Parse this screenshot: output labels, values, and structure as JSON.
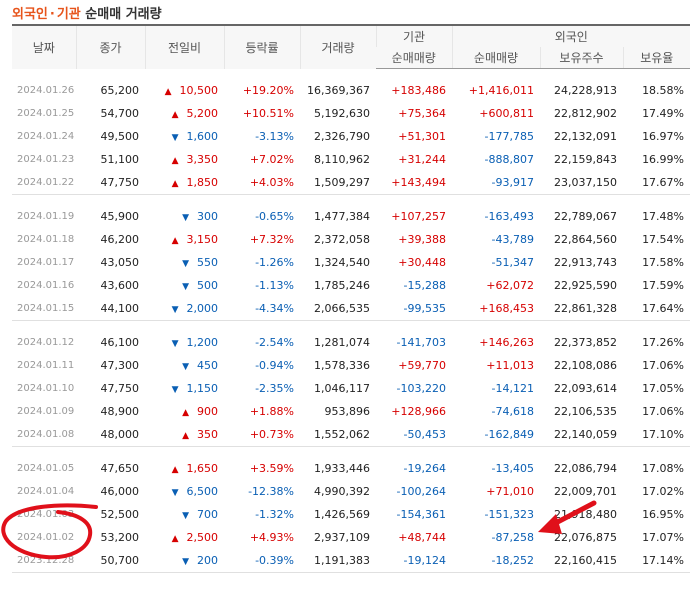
{
  "title": {
    "part1": "외국인",
    "sep": "·",
    "part2": "기관",
    "part3": "순매매 거래량"
  },
  "headers": {
    "date": "날짜",
    "close": "종가",
    "change": "전일비",
    "rate": "등락률",
    "volume": "거래량",
    "inst_group": "기관",
    "foreign_group": "외국인",
    "inst_net": "순매매량",
    "foreign_net": "순매매량",
    "holdings": "보유주수",
    "ratio": "보유율"
  },
  "groups": [
    [
      {
        "date": "2024.01.26",
        "close": "65,200",
        "dir": "up",
        "change": "10,500",
        "rate": "+19.20%",
        "volume": "16,369,367",
        "inst": "+183,486",
        "foreign": "+1,416,011",
        "holdings": "24,228,913",
        "ratio": "18.58%"
      },
      {
        "date": "2024.01.25",
        "close": "54,700",
        "dir": "up",
        "change": "5,200",
        "rate": "+10.51%",
        "volume": "5,192,630",
        "inst": "+75,364",
        "foreign": "+600,811",
        "holdings": "22,812,902",
        "ratio": "17.49%"
      },
      {
        "date": "2024.01.24",
        "close": "49,500",
        "dir": "dn",
        "change": "1,600",
        "rate": "-3.13%",
        "volume": "2,326,790",
        "inst": "+51,301",
        "foreign": "-177,785",
        "holdings": "22,132,091",
        "ratio": "16.97%"
      },
      {
        "date": "2024.01.23",
        "close": "51,100",
        "dir": "up",
        "change": "3,350",
        "rate": "+7.02%",
        "volume": "8,110,962",
        "inst": "+31,244",
        "foreign": "-888,807",
        "holdings": "22,159,843",
        "ratio": "16.99%"
      },
      {
        "date": "2024.01.22",
        "close": "47,750",
        "dir": "up",
        "change": "1,850",
        "rate": "+4.03%",
        "volume": "1,509,297",
        "inst": "+143,494",
        "foreign": "-93,917",
        "holdings": "23,037,150",
        "ratio": "17.67%"
      }
    ],
    [
      {
        "date": "2024.01.19",
        "close": "45,900",
        "dir": "dn",
        "change": "300",
        "rate": "-0.65%",
        "volume": "1,477,384",
        "inst": "+107,257",
        "foreign": "-163,493",
        "holdings": "22,789,067",
        "ratio": "17.48%"
      },
      {
        "date": "2024.01.18",
        "close": "46,200",
        "dir": "up",
        "change": "3,150",
        "rate": "+7.32%",
        "volume": "2,372,058",
        "inst": "+39,388",
        "foreign": "-43,789",
        "holdings": "22,864,560",
        "ratio": "17.54%"
      },
      {
        "date": "2024.01.17",
        "close": "43,050",
        "dir": "dn",
        "change": "550",
        "rate": "-1.26%",
        "volume": "1,324,540",
        "inst": "+30,448",
        "foreign": "-51,347",
        "holdings": "22,913,743",
        "ratio": "17.58%"
      },
      {
        "date": "2024.01.16",
        "close": "43,600",
        "dir": "dn",
        "change": "500",
        "rate": "-1.13%",
        "volume": "1,785,246",
        "inst": "-15,288",
        "foreign": "+62,072",
        "holdings": "22,925,590",
        "ratio": "17.59%"
      },
      {
        "date": "2024.01.15",
        "close": "44,100",
        "dir": "dn",
        "change": "2,000",
        "rate": "-4.34%",
        "volume": "2,066,535",
        "inst": "-99,535",
        "foreign": "+168,453",
        "holdings": "22,861,328",
        "ratio": "17.64%"
      }
    ],
    [
      {
        "date": "2024.01.12",
        "close": "46,100",
        "dir": "dn",
        "change": "1,200",
        "rate": "-2.54%",
        "volume": "1,281,074",
        "inst": "-141,703",
        "foreign": "+146,263",
        "holdings": "22,373,852",
        "ratio": "17.26%"
      },
      {
        "date": "2024.01.11",
        "close": "47,300",
        "dir": "dn",
        "change": "450",
        "rate": "-0.94%",
        "volume": "1,578,336",
        "inst": "+59,770",
        "foreign": "+11,013",
        "holdings": "22,108,086",
        "ratio": "17.06%"
      },
      {
        "date": "2024.01.10",
        "close": "47,750",
        "dir": "dn",
        "change": "1,150",
        "rate": "-2.35%",
        "volume": "1,046,117",
        "inst": "-103,220",
        "foreign": "-14,121",
        "holdings": "22,093,614",
        "ratio": "17.05%"
      },
      {
        "date": "2024.01.09",
        "close": "48,900",
        "dir": "up",
        "change": "900",
        "rate": "+1.88%",
        "volume": "953,896",
        "inst": "+128,966",
        "foreign": "-74,618",
        "holdings": "22,106,535",
        "ratio": "17.06%"
      },
      {
        "date": "2024.01.08",
        "close": "48,000",
        "dir": "up",
        "change": "350",
        "rate": "+0.73%",
        "volume": "1,552,062",
        "inst": "-50,453",
        "foreign": "-162,849",
        "holdings": "22,140,059",
        "ratio": "17.10%"
      }
    ],
    [
      {
        "date": "2024.01.05",
        "close": "47,650",
        "dir": "up",
        "change": "1,650",
        "rate": "+3.59%",
        "volume": "1,933,446",
        "inst": "-19,264",
        "foreign": "-13,405",
        "holdings": "22,086,794",
        "ratio": "17.08%"
      },
      {
        "date": "2024.01.04",
        "close": "46,000",
        "dir": "dn",
        "change": "6,500",
        "rate": "-12.38%",
        "volume": "4,990,392",
        "inst": "-100,264",
        "foreign": "+71,010",
        "holdings": "22,009,701",
        "ratio": "17.02%"
      },
      {
        "date": "2024.01.03",
        "close": "52,500",
        "dir": "dn",
        "change": "700",
        "rate": "-1.32%",
        "volume": "1,426,569",
        "inst": "-154,361",
        "foreign": "-151,323",
        "holdings": "21,918,480",
        "ratio": "16.95%"
      },
      {
        "date": "2024.01.02",
        "close": "53,200",
        "dir": "up",
        "change": "2,500",
        "rate": "+4.93%",
        "volume": "2,937,109",
        "inst": "+48,744",
        "foreign": "-87,258",
        "holdings": "22,076,875",
        "ratio": "17.07%"
      },
      {
        "date": "2023.12.28",
        "close": "50,700",
        "dir": "dn",
        "change": "200",
        "rate": "-0.39%",
        "volume": "1,191,383",
        "inst": "-19,124",
        "foreign": "-18,252",
        "holdings": "22,160,415",
        "ratio": "17.14%"
      }
    ]
  ],
  "colors": {
    "up": "#d60000",
    "down": "#0a5fb4",
    "accent": "#e7541b",
    "annotation": "#e0101a"
  },
  "icons": {
    "up": "▲",
    "down": "▼"
  }
}
